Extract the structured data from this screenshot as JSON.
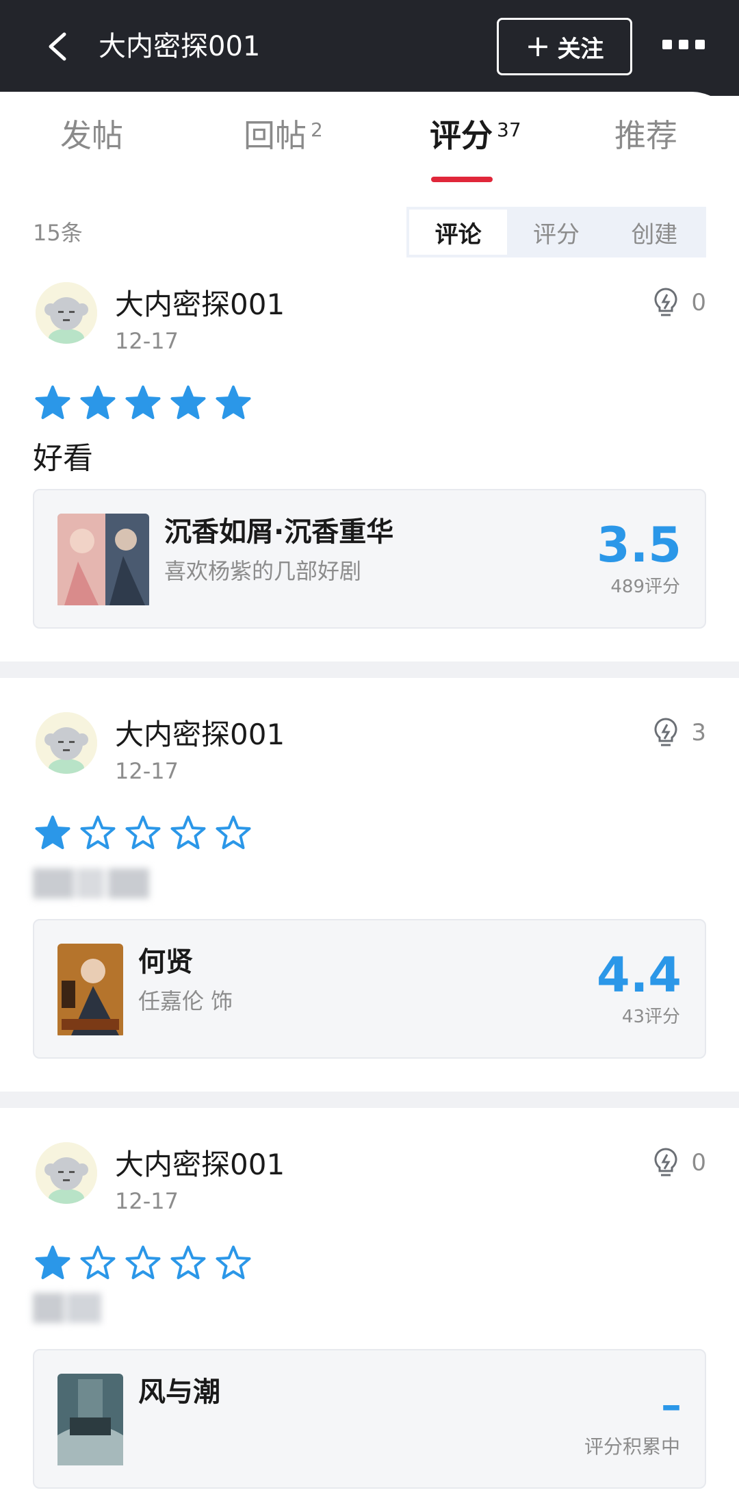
{
  "header": {
    "title": "大内密探001",
    "follow_label": "关注",
    "follow_plus": "+"
  },
  "tabs": [
    {
      "label": "发帖",
      "count": ""
    },
    {
      "label": "回帖",
      "count": "2"
    },
    {
      "label": "评分",
      "count": "37"
    },
    {
      "label": "推荐",
      "count": ""
    }
  ],
  "active_tab": "评分",
  "list": {
    "count_label": "15条",
    "segments": [
      "评论",
      "评分",
      "创建"
    ],
    "active_segment": "评论"
  },
  "reviews": [
    {
      "user": "大内密探001",
      "date": "12-17",
      "likes": "0",
      "rating": 5,
      "text": "好看",
      "card": {
        "title": "沉香如屑·沉香重华",
        "subtitle": "喜欢杨紫的几部好剧",
        "score": "3.5",
        "score_count": "489评分"
      }
    },
    {
      "user": "大内密探001",
      "date": "12-17",
      "likes": "3",
      "rating": 1,
      "text": "",
      "card": {
        "title": "何贤",
        "subtitle": "任嘉伦 饰",
        "score": "4.4",
        "score_count": "43评分"
      }
    },
    {
      "user": "大内密探001",
      "date": "12-17",
      "likes": "0",
      "rating": 1,
      "text": "",
      "card": {
        "title": "风与潮",
        "subtitle": "",
        "score": "–",
        "score_count": "评分积累中"
      }
    }
  ],
  "colors": {
    "accent": "#2b97e8",
    "tab_indicator": "#e0273a",
    "header_bg": "#23252b"
  }
}
